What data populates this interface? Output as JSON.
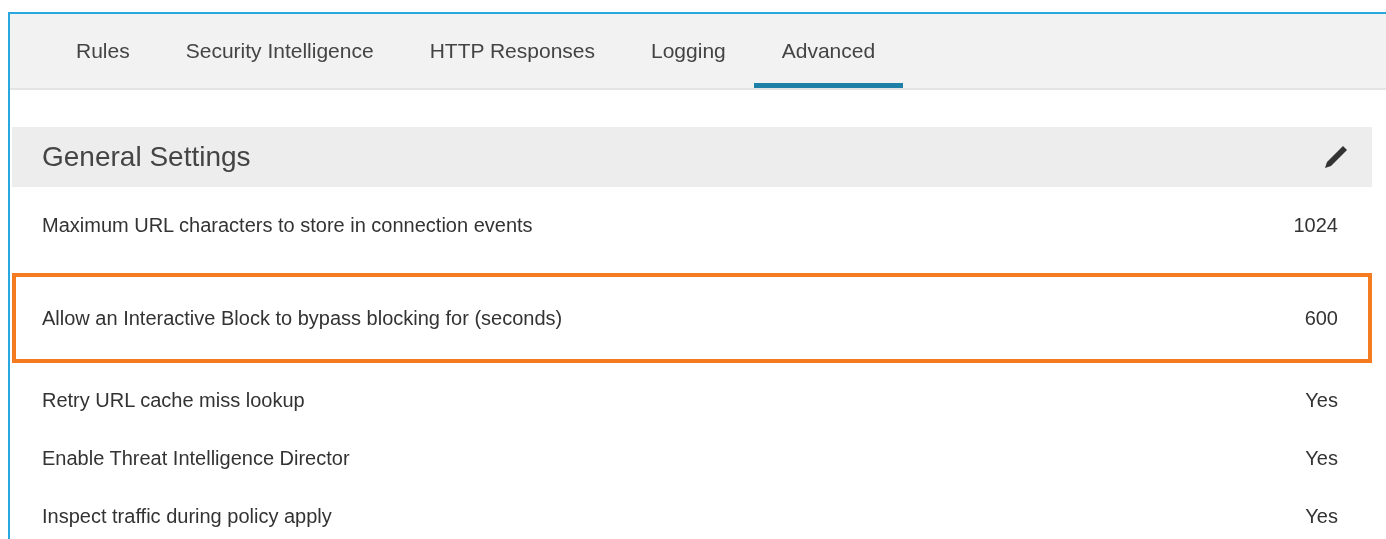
{
  "tabs": [
    {
      "label": "Rules",
      "selected": false
    },
    {
      "label": "Security Intelligence",
      "selected": false
    },
    {
      "label": "HTTP Responses",
      "selected": false
    },
    {
      "label": "Logging",
      "selected": false
    },
    {
      "label": "Advanced",
      "selected": true
    }
  ],
  "section": {
    "title": "General Settings",
    "rows": [
      {
        "label": "Maximum URL characters to store in connection events",
        "value": "1024",
        "highlighted": false
      },
      {
        "label": "Allow an Interactive Block to bypass blocking for (seconds)",
        "value": "600",
        "highlighted": true
      },
      {
        "label": "Retry URL cache miss lookup",
        "value": "Yes",
        "highlighted": false
      },
      {
        "label": "Enable Threat Intelligence Director",
        "value": "Yes",
        "highlighted": false
      },
      {
        "label": "Inspect traffic during policy apply",
        "value": "Yes",
        "highlighted": false
      }
    ]
  }
}
